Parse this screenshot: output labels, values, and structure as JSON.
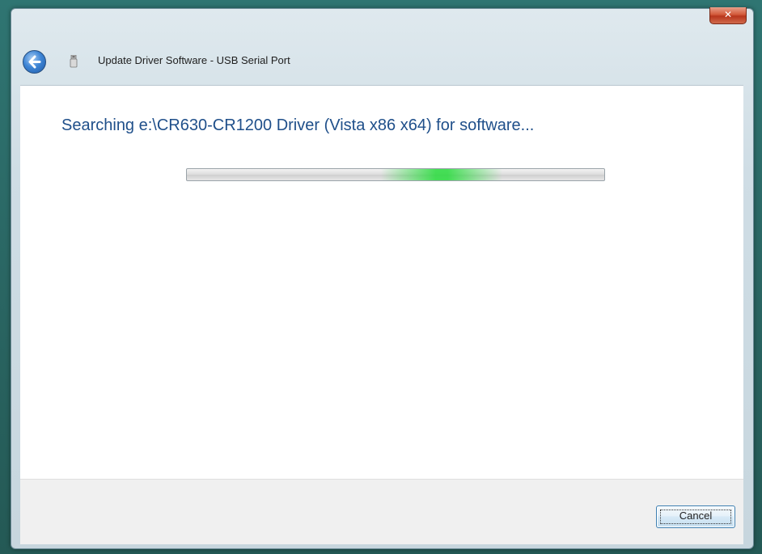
{
  "window": {
    "title": "Update Driver Software - USB Serial Port",
    "close_label": "✕"
  },
  "main": {
    "heading": "Searching e:\\CR630-CR1200 Driver (Vista x86 x64) for software...",
    "progress_state": "indeterminate"
  },
  "footer": {
    "cancel_label": "Cancel"
  },
  "icons": {
    "back": "back-arrow-icon",
    "device": "usb-device-icon",
    "close": "close-icon"
  },
  "colors": {
    "heading": "#1f4f8a",
    "progress_glow": "#28dc3c",
    "close_button": "#c8442a"
  }
}
